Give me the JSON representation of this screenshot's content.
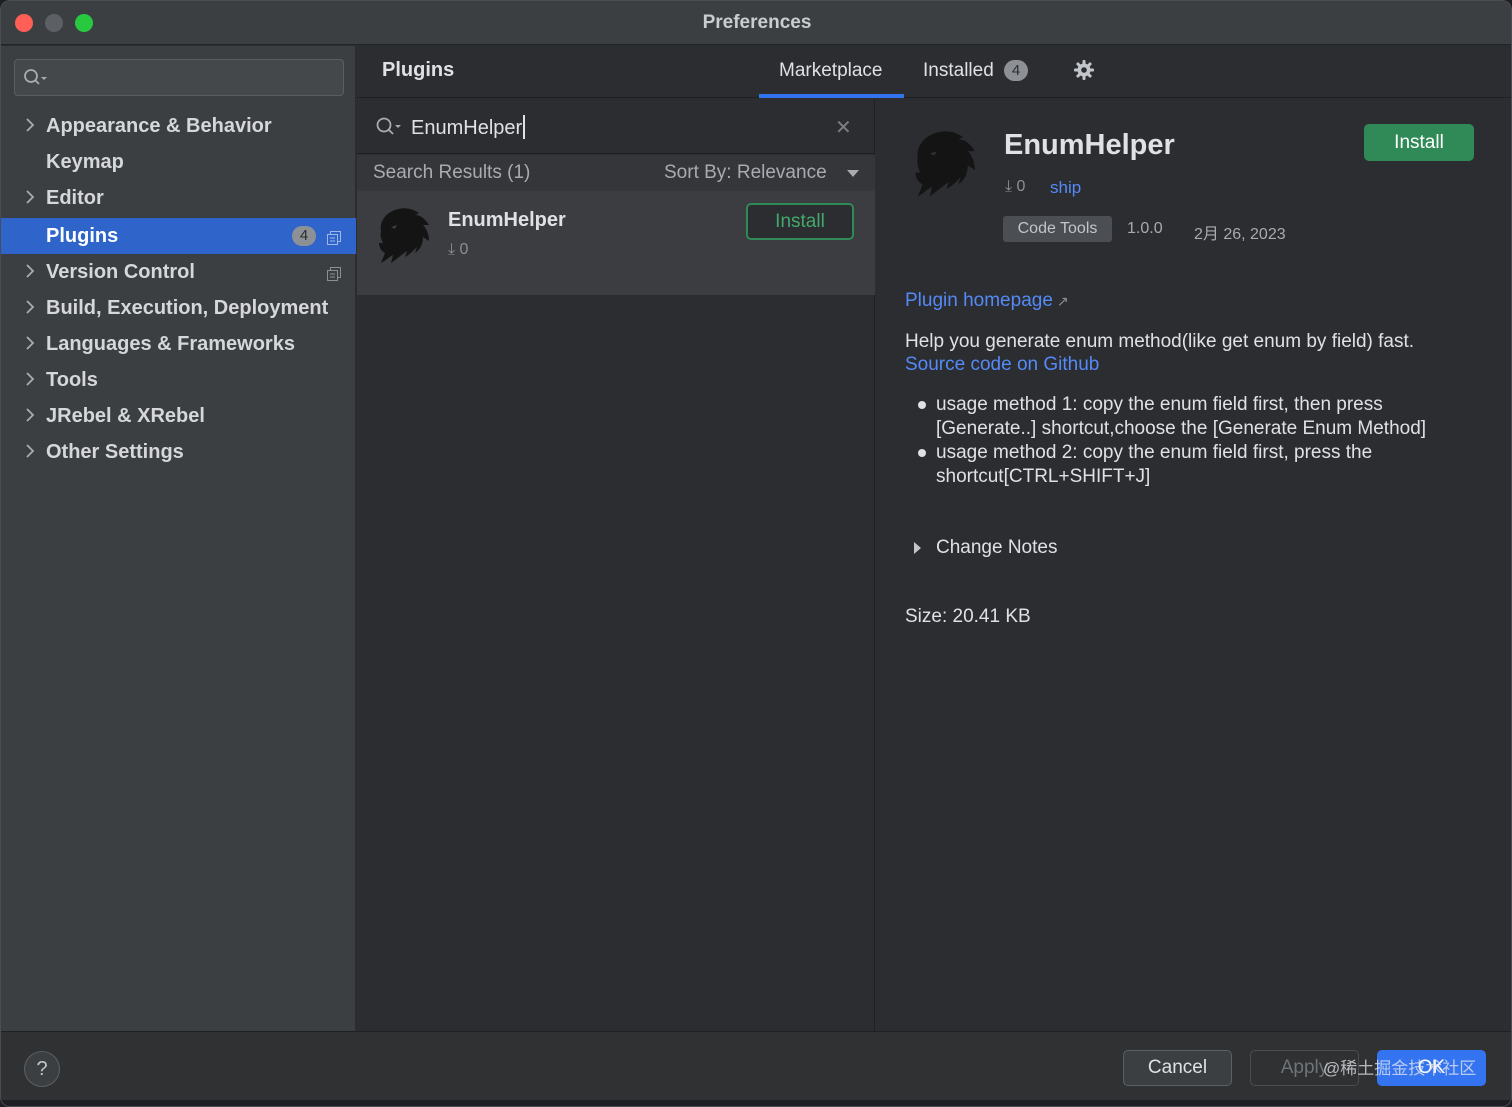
{
  "window": {
    "title": "Preferences"
  },
  "sidebar": {
    "search_placeholder": "",
    "items": [
      {
        "label": "Appearance & Behavior",
        "expandable": true
      },
      {
        "label": "Keymap",
        "expandable": false
      },
      {
        "label": "Editor",
        "expandable": true
      },
      {
        "label": "Plugins",
        "expandable": false,
        "active": true,
        "badge": "4"
      },
      {
        "label": "Version Control",
        "expandable": true
      },
      {
        "label": "Build, Execution, Deployment",
        "expandable": true
      },
      {
        "label": "Languages & Frameworks",
        "expandable": true
      },
      {
        "label": "Tools",
        "expandable": true
      },
      {
        "label": "JRebel & XRebel",
        "expandable": true
      },
      {
        "label": "Other Settings",
        "expandable": true
      }
    ]
  },
  "plugins_header": {
    "title": "Plugins",
    "tabs": {
      "marketplace": "Marketplace",
      "installed": "Installed",
      "installed_badge": "4"
    },
    "selected_tab": "Marketplace"
  },
  "list": {
    "search_query": "EnumHelper",
    "results_count": "Search Results (1)",
    "sort_by": "Sort By: Relevance",
    "results": [
      {
        "name": "EnumHelper",
        "downloads": "0",
        "button": "Install"
      }
    ]
  },
  "detail": {
    "name": "EnumHelper",
    "downloads": "0",
    "vendor": "ship",
    "install_label": "Install",
    "tag": "Code Tools",
    "version": "1.0.0",
    "date": "2月 26, 2023",
    "homepage_label": "Plugin homepage",
    "description": "Help you generate enum method(like get enum by field) fast.",
    "source_link": "Source code on Github",
    "bullets": [
      "usage method 1:  copy the enum field first, then press [Generate..] shortcut,choose the [Generate Enum Method]",
      "usage method 2:  copy the enum field first, press the shortcut[CTRL+SHIFT+J]"
    ],
    "change_notes": "Change Notes",
    "size": "Size: 20.41 KB"
  },
  "footer": {
    "help": "?",
    "cancel": "Cancel",
    "apply": "Apply",
    "ok": "OK",
    "watermark": "@稀土掘金技术社区"
  },
  "colors": {
    "accent": "#3574f0",
    "install_green": "#2f8a57",
    "link": "#548af7",
    "sidebar_active": "#2f65ca"
  }
}
